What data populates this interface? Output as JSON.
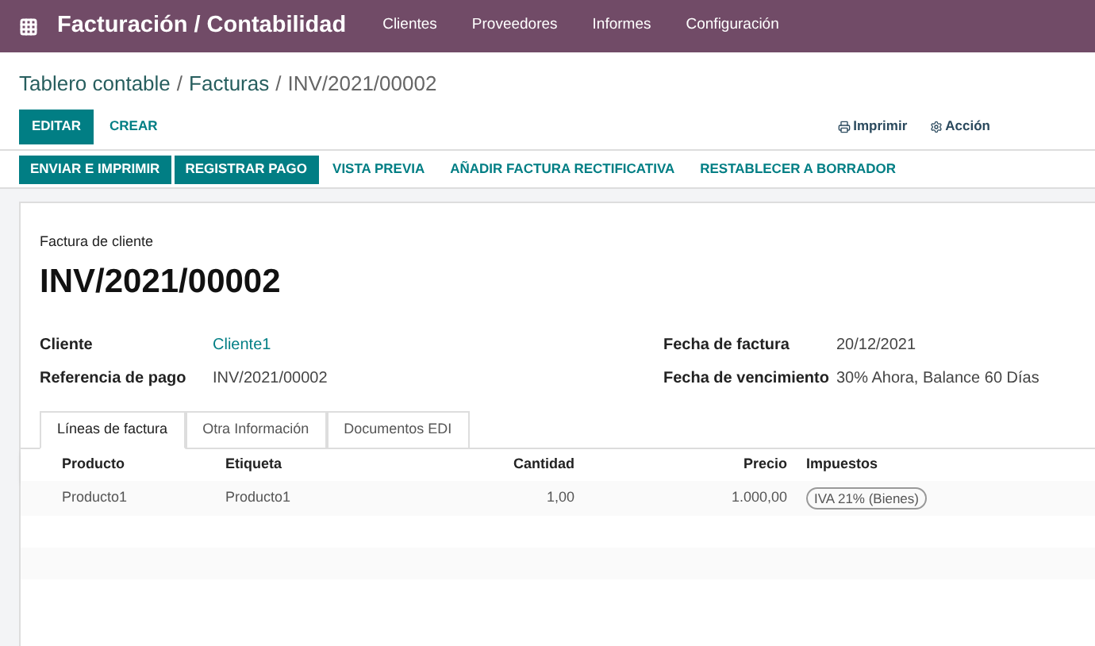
{
  "topbar": {
    "app_title": "Facturación / Contabilidad",
    "menu": [
      "Clientes",
      "Proveedores",
      "Informes",
      "Configuración"
    ]
  },
  "breadcrumb_separator": "/",
  "breadcrumb": [
    {
      "label": "Tablero contable",
      "current": false
    },
    {
      "label": "Facturas",
      "current": false
    },
    {
      "label": "INV/2021/00002",
      "current": true
    }
  ],
  "control_buttons": [
    {
      "label": "EDITAR",
      "kind": "primary"
    },
    {
      "label": "CREAR",
      "kind": "plain"
    }
  ],
  "actions": [
    {
      "label": "Imprimir",
      "kind": "print"
    },
    {
      "label": "Acción",
      "kind": "gear"
    }
  ],
  "status_buttons": [
    {
      "label": "ENVIAR E IMPRIMIR",
      "kind": "primary"
    },
    {
      "label": "REGISTRAR PAGO",
      "kind": "primary"
    },
    {
      "label": "VISTA PREVIA",
      "kind": "plain"
    },
    {
      "label": "AÑADIR FACTURA RECTIFICATIVA",
      "kind": "plain"
    },
    {
      "label": "RESTABLECER A BORRADOR",
      "kind": "plain"
    }
  ],
  "sheet": {
    "subtitle": "Factura de cliente",
    "title": "INV/2021/00002",
    "left_fields": [
      {
        "label": "Cliente",
        "value": "Cliente1",
        "link": true
      },
      {
        "label": "Referencia de pago",
        "value": "INV/2021/00002",
        "link": false
      }
    ],
    "right_fields": [
      {
        "label": "Fecha de factura",
        "value": "20/12/2021",
        "link": false
      },
      {
        "label": "Fecha de vencimiento",
        "value": "30% Ahora, Balance 60 Días",
        "link": false
      }
    ],
    "tabs": [
      {
        "label": "Líneas de factura",
        "selected": true
      },
      {
        "label": "Otra Información",
        "selected": false
      },
      {
        "label": "Documentos EDI",
        "selected": false
      }
    ],
    "table": {
      "columns": [
        "Producto",
        "Etiqueta",
        "Cantidad",
        "Precio",
        "Impuestos"
      ],
      "rows": [
        {
          "producto": "Producto1",
          "etiqueta": "Producto1",
          "cantidad": "1,00",
          "precio": "1.000,00",
          "impuestos": [
            "IVA 21% (Bienes)"
          ]
        }
      ]
    }
  }
}
